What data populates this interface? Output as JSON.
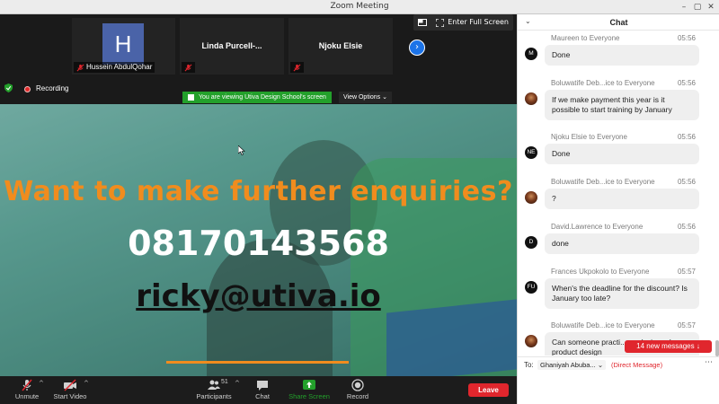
{
  "window": {
    "title": "Zoom Meeting",
    "controls": [
      "minimize-icon",
      "maximize-icon",
      "close-icon"
    ]
  },
  "top_controls": {
    "fullscreen_label": "Enter Full Screen"
  },
  "participants_strip": [
    {
      "name": "Hussein AbdulQohar",
      "initial": "H",
      "muted": true
    },
    {
      "name": "Linda Purcell-...",
      "muted": true
    },
    {
      "name": "Njoku Elsie",
      "muted": true
    }
  ],
  "status": {
    "recording_label": "Recording",
    "viewing_banner": "You are viewing Utiva Design School's screen",
    "view_options_label": "View Options"
  },
  "shared_screen": {
    "headline": "Want to make further enquiries?",
    "phone": "08170143568",
    "email": "ricky@utiva.io"
  },
  "toolbar": {
    "unmute_label": "Unmute",
    "start_video_label": "Start Video",
    "participants_label": "Participants",
    "participants_count": "51",
    "chat_label": "Chat",
    "share_screen_label": "Share Screen",
    "record_label": "Record",
    "leave_label": "Leave"
  },
  "chat": {
    "title": "Chat",
    "messages": [
      {
        "sender": "Maureen to Everyone",
        "time": "05:56",
        "initials": "M",
        "photo": false,
        "text": "Done"
      },
      {
        "sender": "Boluwatife Deb...ice to Everyone",
        "time": "05:56",
        "initials": "",
        "photo": true,
        "text": "If we make payment this year is it possible to start training by January"
      },
      {
        "sender": "Njoku Elsie to Everyone",
        "time": "05:56",
        "initials": "NE",
        "photo": false,
        "text": "Done"
      },
      {
        "sender": "Boluwatife Deb...ice to Everyone",
        "time": "05:56",
        "initials": "",
        "photo": true,
        "text": "?"
      },
      {
        "sender": "David.Lawrence to Everyone",
        "time": "05:56",
        "initials": "D",
        "photo": false,
        "text": "done"
      },
      {
        "sender": "Frances Ukpokolo to Everyone",
        "time": "05:57",
        "initials": "FU",
        "photo": false,
        "text": "When's the deadline for the discount? Is January too late?"
      },
      {
        "sender": "Boluwatife Deb...ice to Everyone",
        "time": "05:57",
        "initials": "",
        "photo": true,
        "text": "Can someone practi... analysis and product design"
      }
    ],
    "new_messages_label": "14 new messages",
    "to_label": "To:",
    "recipient": "Ghaniyah Abuba...",
    "direct_message_label": "(Direct Message)"
  },
  "colors": {
    "leave_red": "#e0262d",
    "accent_blue": "#1b73e8",
    "banner_green": "#23a02b",
    "headline_orange": "#f08c1e",
    "share_active_green": "#23a02b"
  }
}
